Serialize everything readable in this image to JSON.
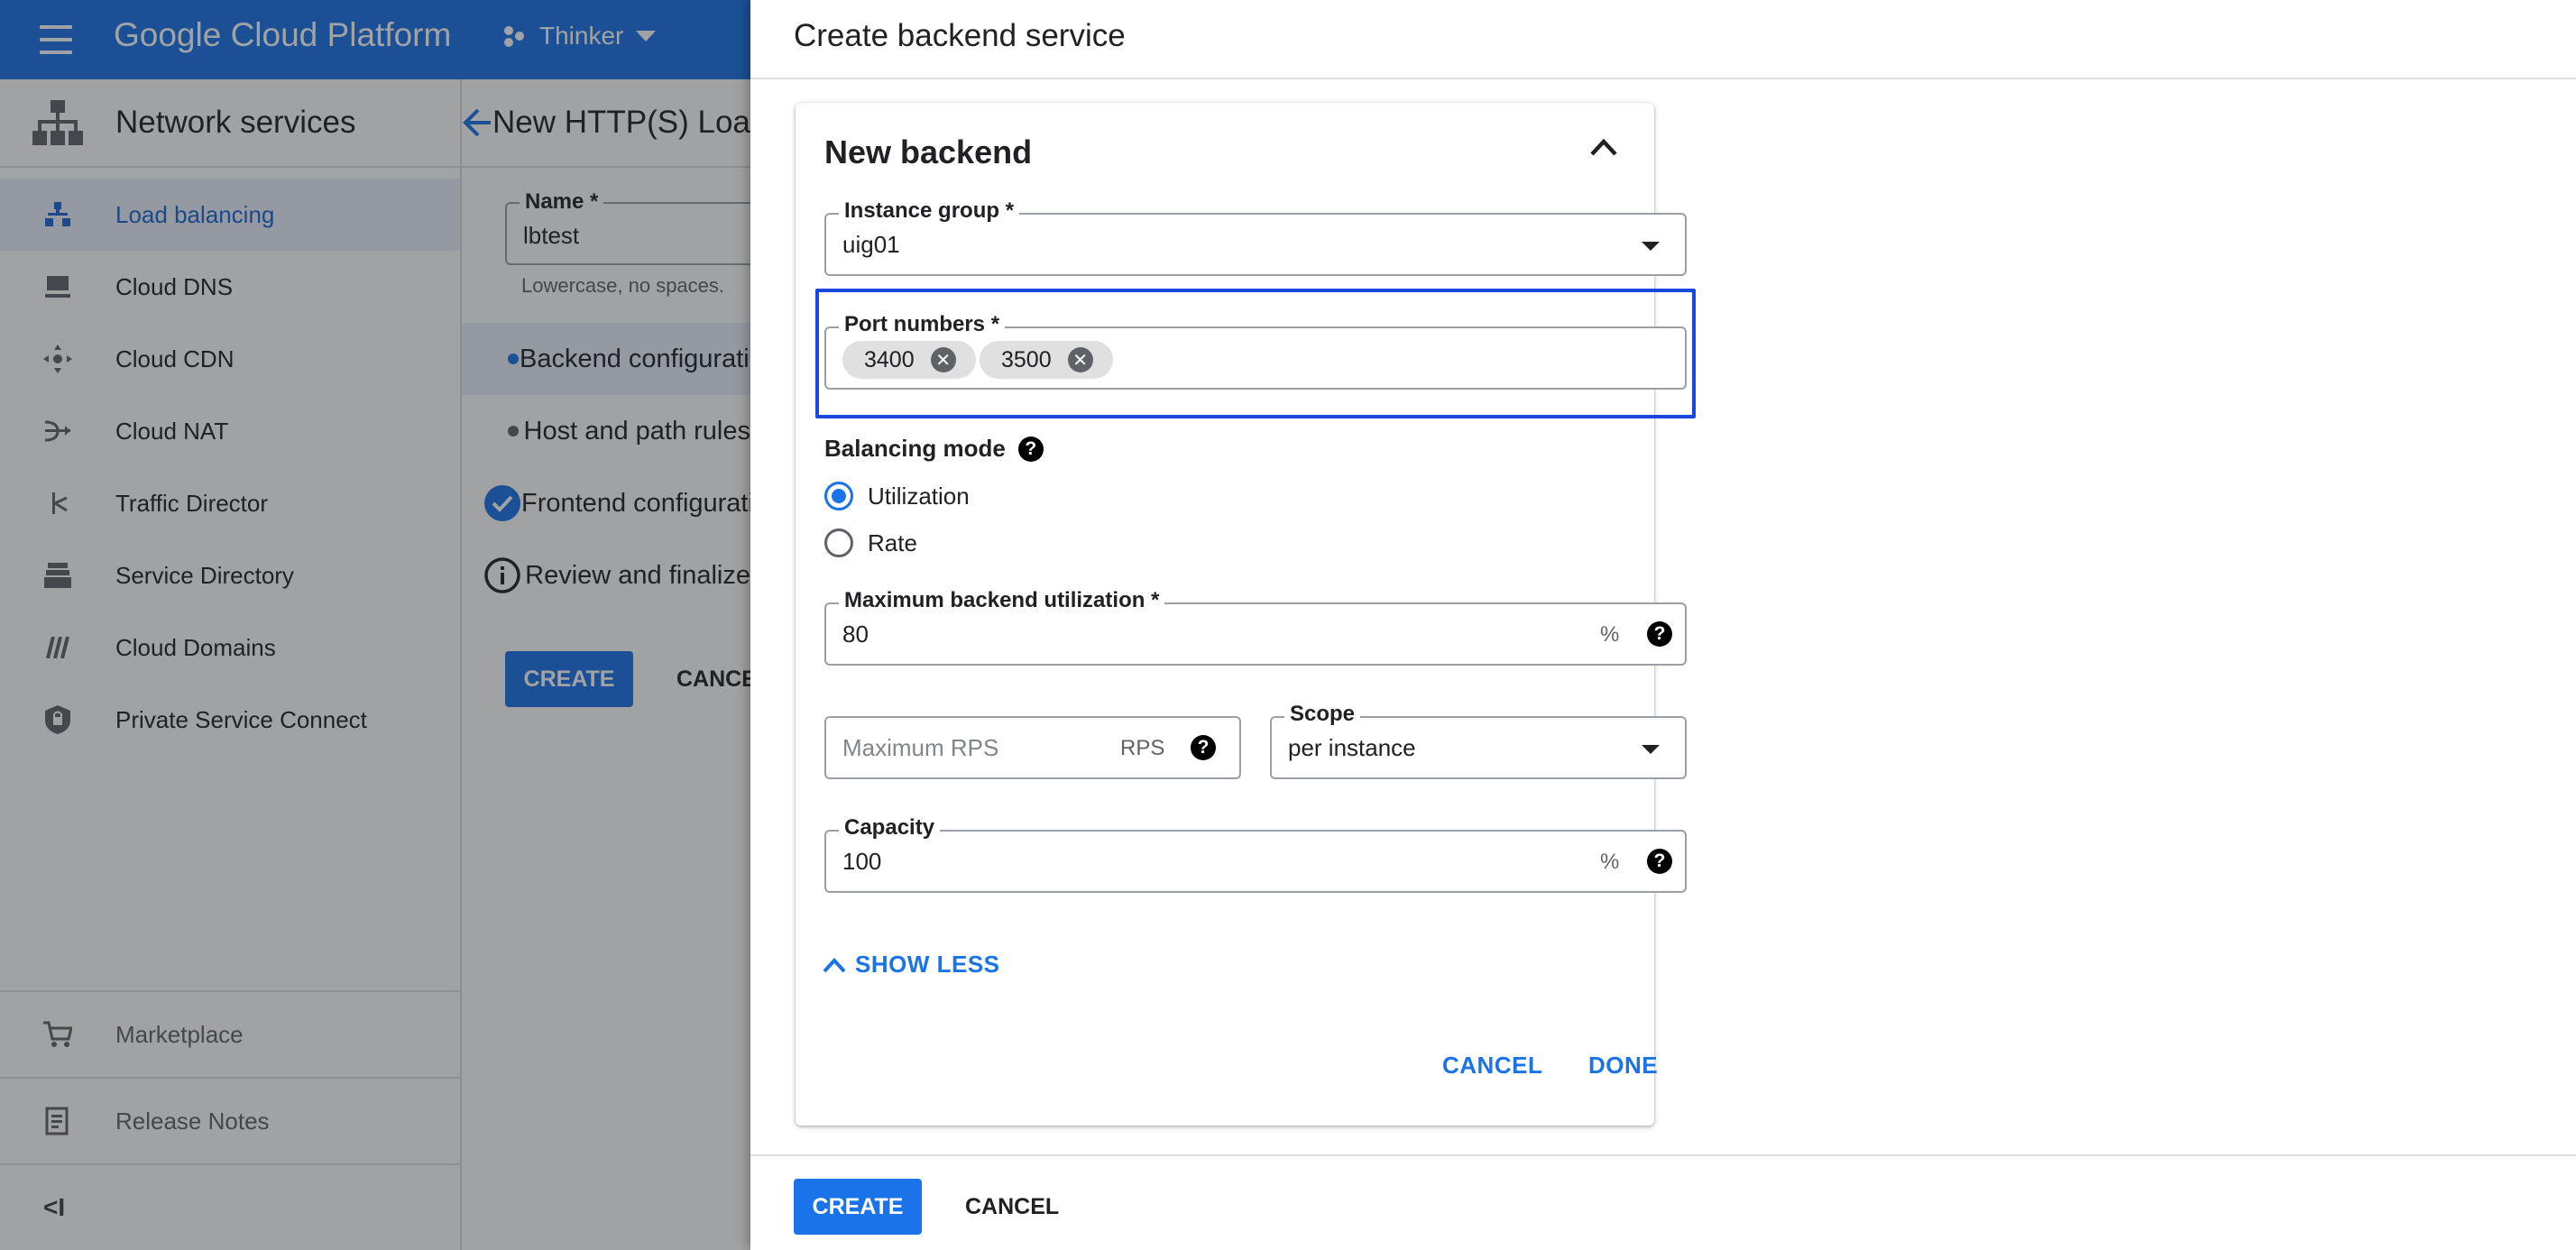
{
  "app": {
    "brand": "Google Cloud Platform",
    "project": "Thinker"
  },
  "sidebar": {
    "title": "Network services",
    "items": [
      {
        "label": "Load balancing"
      },
      {
        "label": "Cloud DNS"
      },
      {
        "label": "Cloud CDN"
      },
      {
        "label": "Cloud NAT"
      },
      {
        "label": "Traffic Director"
      },
      {
        "label": "Service Directory"
      },
      {
        "label": "Cloud Domains"
      },
      {
        "label": "Private Service Connect"
      }
    ],
    "bottom": [
      {
        "label": "Marketplace"
      },
      {
        "label": "Release Notes"
      }
    ],
    "collapse": "<I"
  },
  "main": {
    "title": "New HTTP(S) Load Balancer",
    "name_label": "Name *",
    "name_value": "lbtest",
    "name_hint": "Lowercase, no spaces.",
    "steps": [
      {
        "label": "Backend configuration"
      },
      {
        "label": "Host and path rules"
      },
      {
        "label": "Frontend configuration"
      },
      {
        "label": "Review and finalize"
      }
    ],
    "create": "CREATE",
    "cancel": "CANCEL"
  },
  "panel": {
    "title": "Create backend service",
    "card": {
      "title": "New backend",
      "instance_group": {
        "label": "Instance group *",
        "value": "uig01"
      },
      "port_numbers": {
        "label": "Port numbers *",
        "chips": [
          "3400",
          "3500"
        ]
      },
      "balancing_mode": {
        "label": "Balancing mode",
        "options": [
          {
            "label": "Utilization",
            "selected": true
          },
          {
            "label": "Rate",
            "selected": false
          }
        ]
      },
      "max_util": {
        "label": "Maximum backend utilization *",
        "value": "80",
        "unit": "%"
      },
      "max_rps": {
        "placeholder": "Maximum RPS",
        "unit": "RPS"
      },
      "scope": {
        "label": "Scope",
        "value": "per instance"
      },
      "capacity": {
        "label": "Capacity",
        "value": "100",
        "unit": "%"
      },
      "show_less": "SHOW LESS",
      "cancel": "CANCEL",
      "done": "DONE"
    },
    "footer": {
      "create": "CREATE",
      "cancel": "CANCEL"
    }
  },
  "colors": {
    "accent": "#1a73e8",
    "focus": "#1a47e0",
    "scrim": "rgba(32,33,36,0.42)"
  }
}
